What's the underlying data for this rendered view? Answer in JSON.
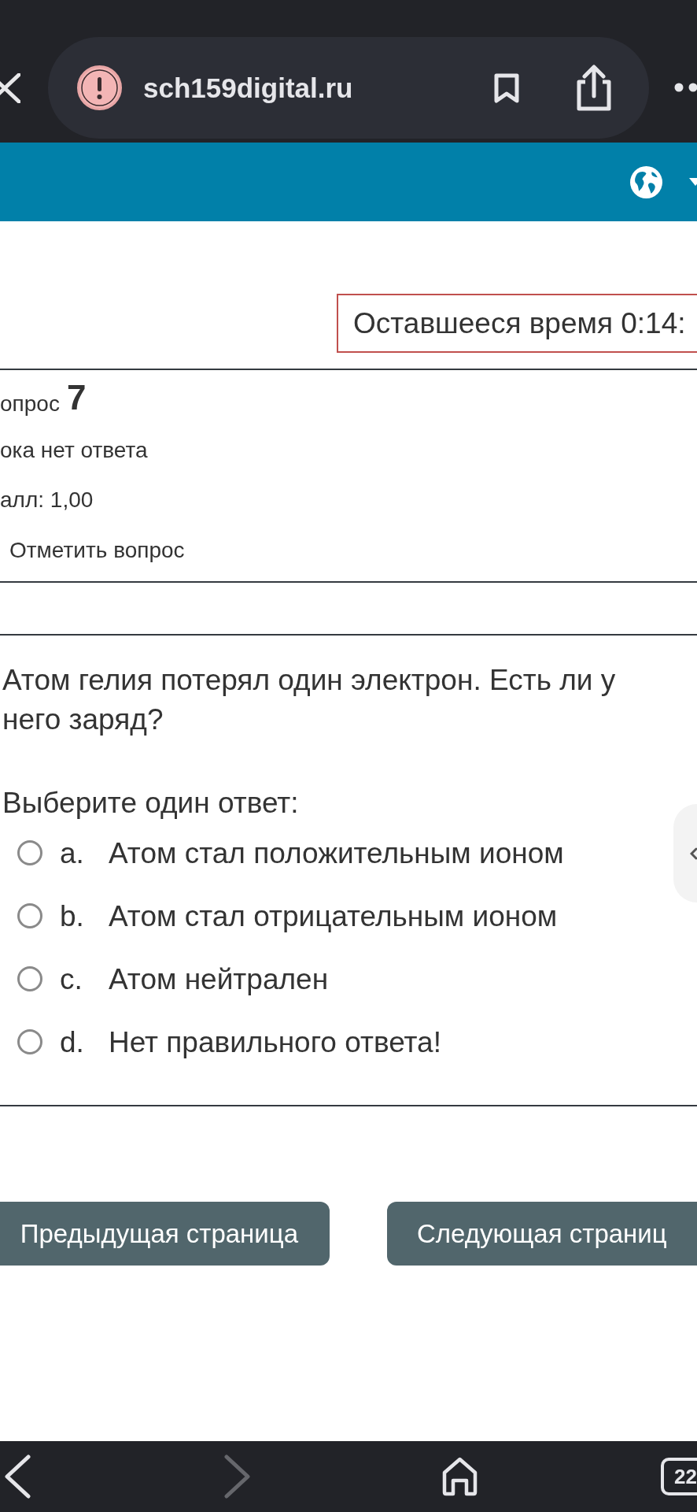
{
  "browser": {
    "url": "sch159digital.ru",
    "forward_disabled": true,
    "tab_count": "22"
  },
  "timer": {
    "text": "Оставшееся время 0:14:"
  },
  "question_info": {
    "title": "опрос",
    "number": "7",
    "status": "ока нет ответа",
    "mark": "алл: 1,00",
    "flag_label": "Отметить вопрос"
  },
  "question": {
    "text": "Атом гелия потерял один электрон. Есть ли у него заряд?",
    "prompt": "Выберите один ответ:",
    "options": [
      {
        "letter": "a.",
        "text": "Атом стал положительным ионом",
        "selected": false
      },
      {
        "letter": "b.",
        "text": "Атом стал отрицательным ионом",
        "selected": false
      },
      {
        "letter": "c.",
        "text": "Атом нейтрален",
        "selected": false
      },
      {
        "letter": "d.",
        "text": "Нет правильного ответа!",
        "selected": false
      }
    ]
  },
  "navigation": {
    "previous": "Предыдущая страница",
    "next": "Следующая страниц"
  }
}
